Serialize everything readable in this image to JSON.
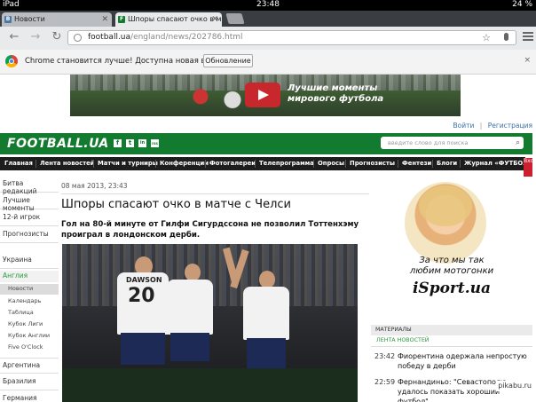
{
  "status_bar": {
    "device": "iPad",
    "time": "23:48",
    "battery": "24 %"
  },
  "tabs": [
    {
      "label": "Новости",
      "favicon": "В"
    },
    {
      "label": "Шпоры спасают очко в ма",
      "favicon": "F"
    }
  ],
  "toolbar": {
    "url_domain": "football.ua",
    "url_path": "/england/news/202786.html"
  },
  "infobar": {
    "message": "Chrome становится лучше! Доступна новая версия.",
    "update_button": "Обновление",
    "close": "×"
  },
  "banner": {
    "line1": "Лучшие моменты",
    "line2": "мирового футбола"
  },
  "auth": {
    "login": "Войти",
    "separator": "|",
    "register": "Регистрация"
  },
  "header": {
    "logo": "FOOTBALL.UA",
    "social": [
      "f",
      "t",
      "in",
      "rss"
    ],
    "search_placeholder": "введите слово для поиска"
  },
  "nav": [
    "Главная",
    "Лента новостей",
    "Матчи и турниры",
    "Конференции",
    "Фотогалереи",
    "Телепрограмма",
    "Опросы",
    "Прогнозисты",
    "Фентези",
    "Блоги",
    "Журнал «ФУТБОЛ»"
  ],
  "nav_login": "Вход",
  "sidebar": {
    "top": [
      "Битва редакций",
      "Лучшие моменты",
      "12-й игрок",
      "Прогнозисты"
    ],
    "country1": "Украина",
    "active_section": "Англия",
    "sub": [
      "Новости",
      "Календарь",
      "Таблица",
      "Кубок Лиги",
      "Кубок Англии",
      "Five O'Clock"
    ],
    "more": [
      "Аргентина",
      "Бразилия",
      "Германия"
    ]
  },
  "article": {
    "date": "08 мая 2013, 23:43",
    "title": "Шпоры спасают очко в матче с Челси",
    "lead": "Гол на 80-й минуте от Гилфи Сигурдссона не позволил Тоттенхэму проиграл в лондонском дерби.",
    "photo": {
      "jersey_name": "DAWSON",
      "jersey_number": "20"
    }
  },
  "promo": {
    "tagline1": "За что мы так",
    "tagline2": "любим мотогонки",
    "brand": "iSport.ua"
  },
  "materials": {
    "header": "МАТЕРИАЛЫ",
    "tab": "ЛЕНТА НОВОСТЕЙ",
    "items": [
      {
        "time": "23:42",
        "title": "Фиорентина одержала непростую победу в дерби"
      },
      {
        "time": "22:59",
        "title": "Фернандиньо: \"Севастополю удалось показать хороший футбол\""
      }
    ]
  },
  "watermark": "pikabu.ru"
}
